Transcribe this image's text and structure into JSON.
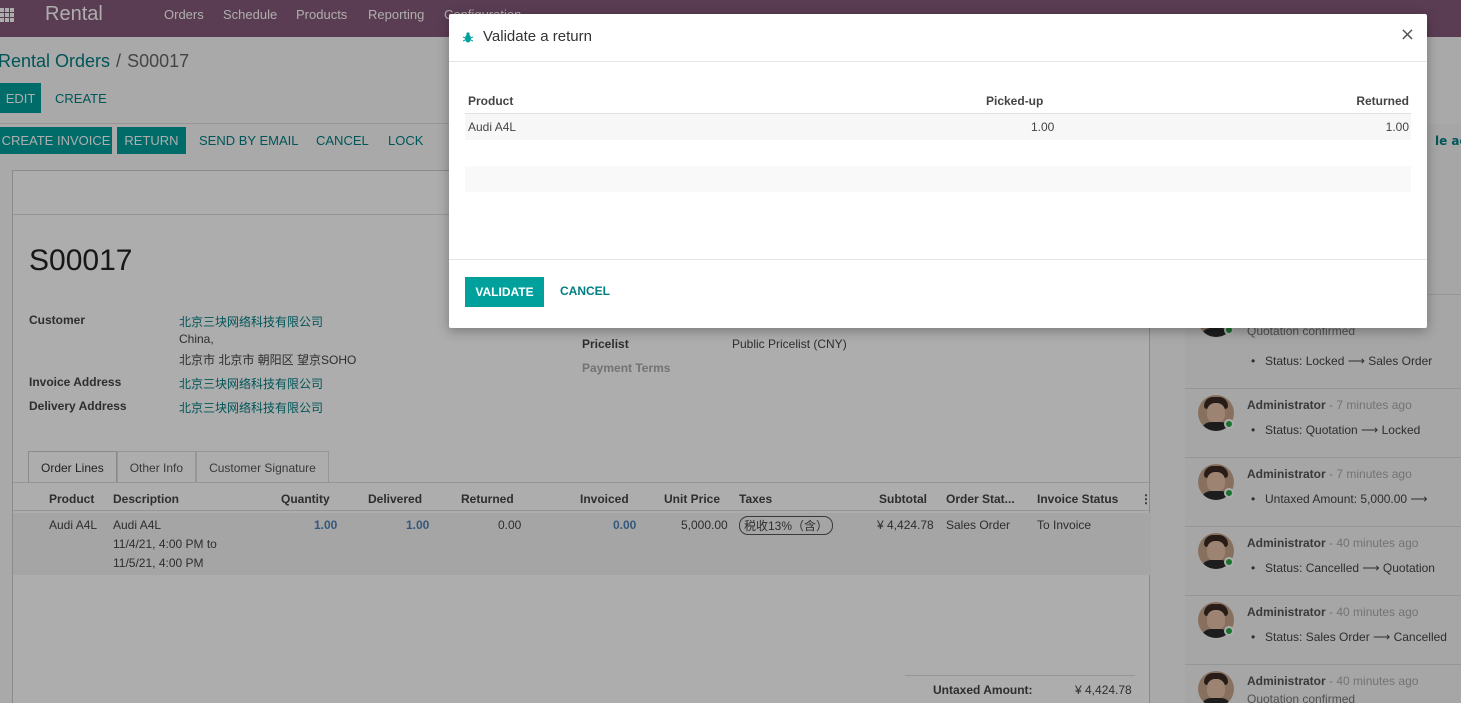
{
  "navbar": {
    "brand": "Rental",
    "menu": [
      "Orders",
      "Schedule",
      "Products",
      "Reporting",
      "Configuration"
    ]
  },
  "breadcrumb": {
    "parent": "Rental Orders",
    "separator": "/",
    "current": "S00017"
  },
  "control": {
    "edit": "EDIT",
    "create": "CREATE"
  },
  "actions": {
    "create_invoice": "CREATE INVOICE",
    "return": "RETURN",
    "send_by_email": "SEND BY EMAIL",
    "cancel": "CANCEL",
    "lock": "LOCK"
  },
  "form": {
    "title": "S00017",
    "customer_label": "Customer",
    "customer_name": "北京三块网络科技有限公司",
    "customer_line2": "China,",
    "customer_line3": "北京市 北京市 朝阳区 望京SOHO",
    "invoice_address_label": "Invoice Address",
    "invoice_address": "北京三块网络科技有限公司",
    "delivery_address_label": "Delivery Address",
    "delivery_address": "北京三块网络科技有限公司",
    "pricelist_label": "Pricelist",
    "pricelist": "Public Pricelist (CNY)",
    "payment_terms_label": "Payment Terms"
  },
  "tabs": [
    "Order Lines",
    "Other Info",
    "Customer Signature"
  ],
  "order_lines": {
    "headers": [
      "Product",
      "Description",
      "Quantity",
      "Delivered",
      "Returned",
      "Invoiced",
      "Unit Price",
      "Taxes",
      "Subtotal",
      "Order Stat...",
      "Invoice Status"
    ],
    "row": {
      "product": "Audi A4L",
      "desc1": "Audi A4L",
      "desc2": "11/4/21, 4:00 PM to",
      "desc3": "11/5/21, 4:00 PM",
      "quantity": "1.00",
      "delivered": "1.00",
      "returned": "0.00",
      "invoiced": "0.00",
      "unit_price": "5,000.00",
      "taxes": "税收13%（含）",
      "subtotal": "¥ 4,424.78",
      "order_status": "Sales Order",
      "invoice_status": "To Invoice"
    }
  },
  "totals": {
    "untaxed_label": "Untaxed Amount:",
    "untaxed_value": "¥ 4,424.78"
  },
  "chatter": {
    "side_text": "le act",
    "messages": [
      {
        "author": "",
        "time": "",
        "subtitle": "Quotation confirmed",
        "bullet": "Status: Locked ⟶ Sales Order"
      },
      {
        "author": "Administrator",
        "time": "- 7 minutes ago",
        "subtitle": "",
        "bullet": "Status: Quotation ⟶ Locked"
      },
      {
        "author": "Administrator",
        "time": "- 7 minutes ago",
        "subtitle": "",
        "bullet": "Untaxed Amount: 5,000.00 ⟶"
      },
      {
        "author": "Administrator",
        "time": "- 40 minutes ago",
        "subtitle": "",
        "bullet": "Status: Cancelled ⟶ Quotation"
      },
      {
        "author": "Administrator",
        "time": "- 40 minutes ago",
        "subtitle": "",
        "bullet": "Status: Sales Order ⟶ Cancelled"
      },
      {
        "author": "Administrator",
        "time": "- 40 minutes ago",
        "subtitle": "Quotation confirmed",
        "bullet": ""
      }
    ]
  },
  "modal": {
    "title": "Validate a return",
    "close": "×",
    "headers": {
      "product": "Product",
      "picked_up": "Picked-up",
      "returned": "Returned"
    },
    "row": {
      "product": "Audi A4L",
      "picked_up": "1.00",
      "returned": "1.00"
    },
    "validate": "VALIDATE",
    "cancel": "CANCEL"
  },
  "colors": {
    "navbar": "#875a7b",
    "primary": "#00a09d",
    "link": "#017e84"
  },
  "icons": {
    "apps": "apps-grid-icon",
    "bug": "bug-icon",
    "close": "close-icon",
    "kebab": "kebab-menu-icon"
  }
}
